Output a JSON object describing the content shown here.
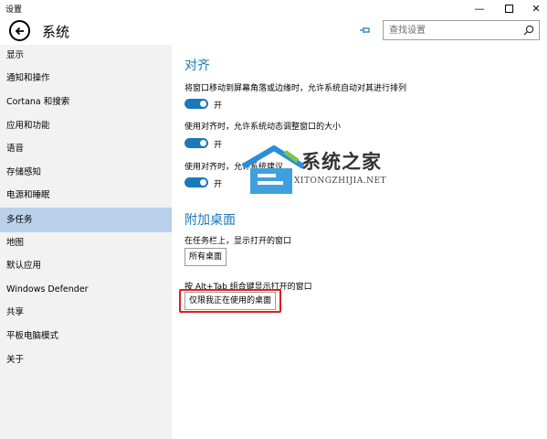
{
  "window": {
    "title": "设置",
    "minimize_glyph": "—",
    "close_glyph": "✕"
  },
  "header": {
    "title": "系统",
    "search_placeholder": "查找设置"
  },
  "sidebar": {
    "items": [
      {
        "label": "显示"
      },
      {
        "label": "通知和操作"
      },
      {
        "label": "Cortana 和搜索"
      },
      {
        "label": "应用和功能"
      },
      {
        "label": "语音"
      },
      {
        "label": "存储感知"
      },
      {
        "label": "电源和睡眠"
      },
      {
        "label": "多任务",
        "active": true
      },
      {
        "label": "地图"
      },
      {
        "label": "默认应用"
      },
      {
        "label": "Windows Defender"
      },
      {
        "label": "共享"
      },
      {
        "label": "平板电脑模式"
      },
      {
        "label": "关于"
      }
    ]
  },
  "snap": {
    "title": "对齐",
    "option1_desc": "将窗口移动到屏幕角落或边缘时，允许系统自动对其进行排列",
    "option1_state": "开",
    "option2_desc": "使用对齐时，允许系统动态调整窗口的大小",
    "option2_state": "开",
    "option3_desc": "使用对齐时，允许系统建议...",
    "option3_state": "开"
  },
  "virtual_desktops": {
    "title": "附加桌面",
    "taskbar_desc": "在任务栏上，显示打开的窗口",
    "taskbar_value": "所有桌面",
    "alttab_desc": "按 Alt+Tab 组合键显示打开的窗口",
    "alttab_value": "仅限我正在使用的桌面"
  },
  "watermark": {
    "text": "系统之家",
    "sub": "XITONGZHIJIA.NET"
  },
  "colors": {
    "accent": "#1a79b8",
    "sidebar_bg": "#f2f2f2",
    "active_item_bg": "#b9d1ea",
    "highlight": "#e31c1c"
  }
}
